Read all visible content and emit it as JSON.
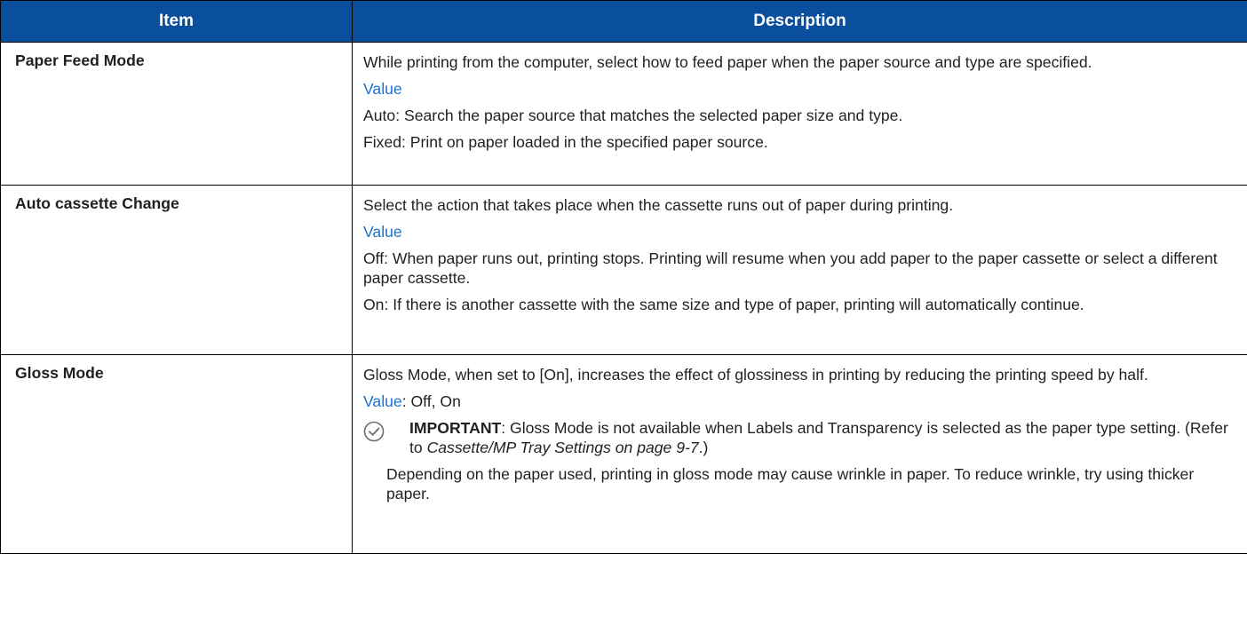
{
  "table": {
    "headers": {
      "item": "Item",
      "description": "Description"
    },
    "rows": [
      {
        "item": "Paper Feed Mode",
        "intro": "While printing from the computer, select how to feed paper when the paper source and type are specified.",
        "value_label": "Value",
        "options": [
          "Auto: Search the paper source that matches the selected paper size and type.",
          "Fixed: Print on paper loaded in the specified paper source."
        ]
      },
      {
        "item": "Auto cassette Change",
        "intro": "Select the action that takes place when the cassette runs out of paper during printing.",
        "value_label": "Value",
        "options": [
          "Off: When paper runs out, printing stops. Printing will resume when you add paper to the paper cassette or select a different paper cassette.",
          "On: If there is another cassette with the same size and type of paper, printing will automatically continue."
        ]
      },
      {
        "item": "Gloss Mode",
        "intro": "Gloss Mode, when set to [On], increases the effect of glossiness in printing by reducing the printing speed by half.",
        "value_label": "Value",
        "value_text": ": Off, On",
        "important_label": "IMPORTANT",
        "important_text": ": Gloss Mode is not available when Labels and Transparency is selected as the paper type setting. (Refer to ",
        "important_ref": "Cassette/MP Tray Settings on page 9-7",
        "important_end": ".)",
        "note": "Depending on the paper used, printing in gloss mode may cause wrinkle in paper. To reduce wrinkle, try using thicker paper."
      }
    ]
  },
  "colors": {
    "header_bg": "#0a4f9e",
    "header_text": "#ffffff",
    "value_label": "#1a73c9",
    "text": "#231f20"
  },
  "icons": {
    "important": "check-circle-icon"
  }
}
